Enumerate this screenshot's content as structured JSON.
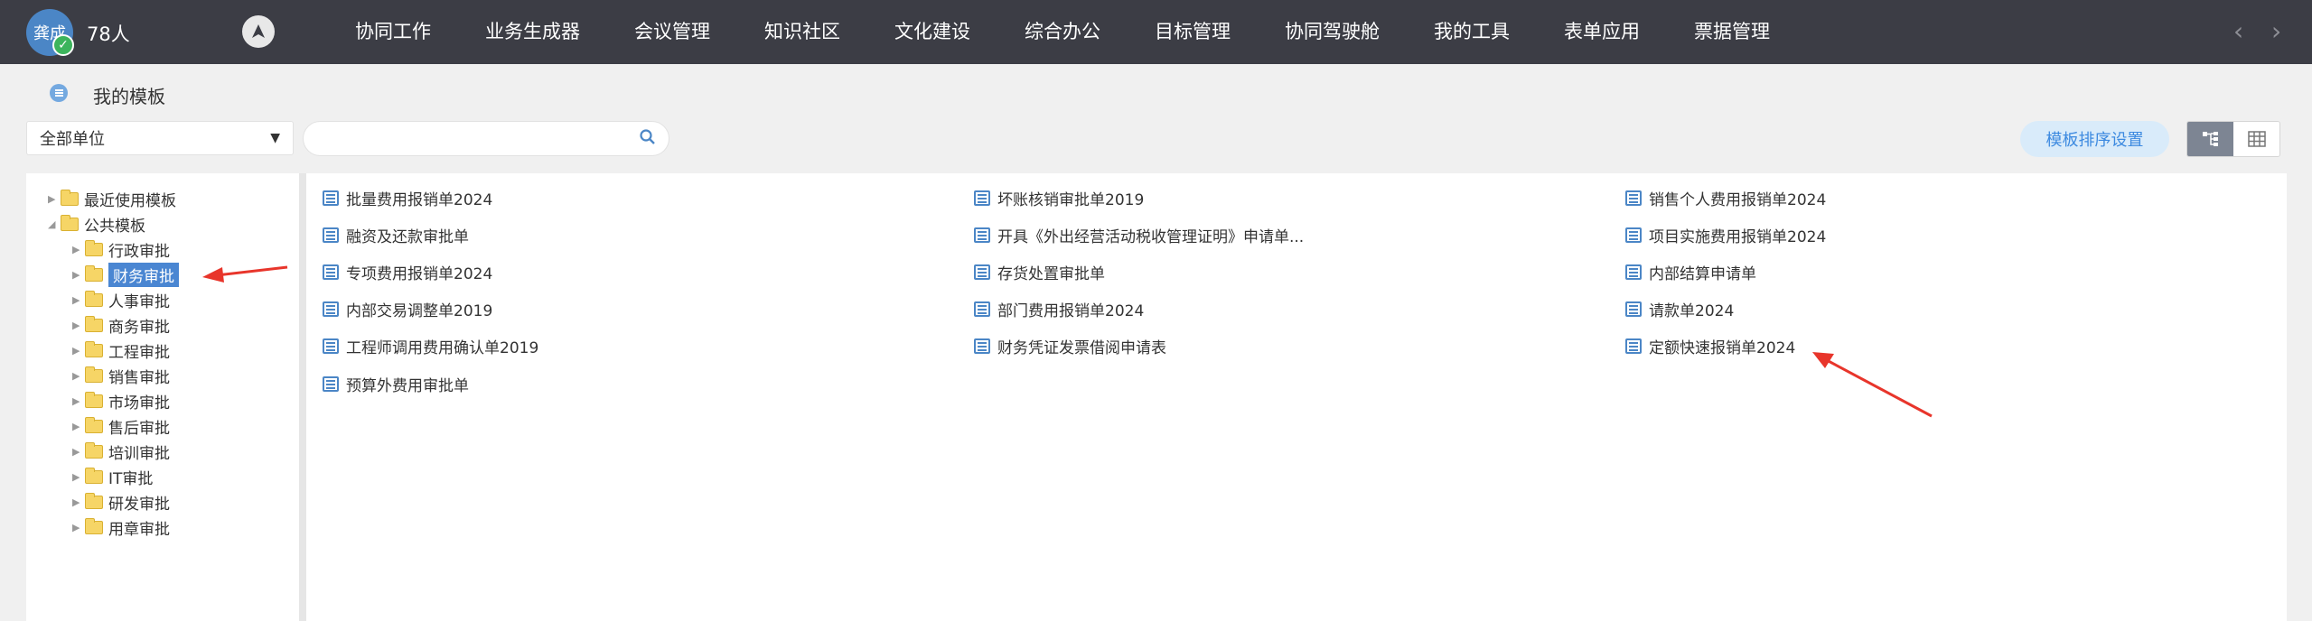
{
  "header": {
    "avatar_text": "龚成",
    "online_count": "78人",
    "nav": [
      "协同工作",
      "业务生成器",
      "会议管理",
      "知识社区",
      "文化建设",
      "综合办公",
      "目标管理",
      "协同驾驶舱",
      "我的工具",
      "表单应用",
      "票据管理"
    ],
    "prev_arrow": "‹",
    "next_arrow": "›"
  },
  "breadcrumb": {
    "title": "我的模板"
  },
  "toolbar": {
    "unit_select_value": "全部单位",
    "search_value": "",
    "sort_button": "模板排序设置"
  },
  "tree": {
    "recent": "最近使用模板",
    "public": "公共模板",
    "children": [
      "行政审批",
      "财务审批",
      "人事审批",
      "商务审批",
      "工程审批",
      "销售审批",
      "市场审批",
      "售后审批",
      "培训审批",
      "IT审批",
      "研发审批",
      "用章审批"
    ],
    "selected_index": 1
  },
  "templates": {
    "col1": [
      "批量费用报销单2024",
      "融资及还款审批单",
      "专项费用报销单2024",
      "内部交易调整单2019",
      "工程师调用费用确认单2019",
      "预算外费用审批单"
    ],
    "col2": [
      "坏账核销审批单2019",
      "开具《外出经营活动税收管理证明》申请单...",
      "存货处置审批单",
      "部门费用报销单2024",
      "财务凭证发票借阅申请表"
    ],
    "col3": [
      "销售个人费用报销单2024",
      "项目实施费用报销单2024",
      "内部结算申请单",
      "请款单2024",
      "定额快速报销单2024"
    ]
  },
  "colors": {
    "topbar": "#3c3d45",
    "accent": "#4b86c6",
    "annotation": "#e8352b"
  }
}
